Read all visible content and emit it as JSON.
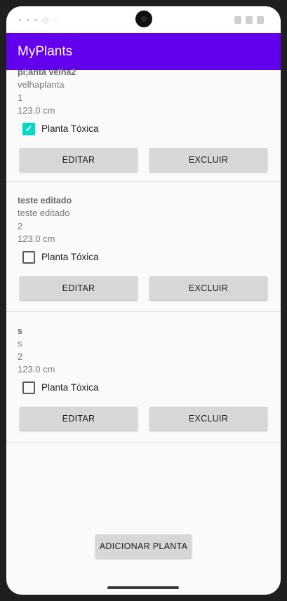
{
  "app": {
    "title": "MyPlants"
  },
  "status_bar": {
    "left_text": "▪ ▪ ▪ ◷  ◌"
  },
  "plants": [
    {
      "name": "pl;anta velha2",
      "description": "velhaplanta",
      "quantity": "1",
      "height": "123.0 cm",
      "toxic_label": "Planta Tóxica",
      "toxic_checked": true,
      "edit_label": "EDITAR",
      "delete_label": "EXCLUIR"
    },
    {
      "name": "teste editado",
      "description": "teste editado",
      "quantity": "2",
      "height": "123.0 cm",
      "toxic_label": "Planta Tóxica",
      "toxic_checked": false,
      "edit_label": "EDITAR",
      "delete_label": "EXCLUIR"
    },
    {
      "name": "s",
      "description": "s",
      "quantity": "2",
      "height": "123.0 cm",
      "toxic_label": "Planta Tóxica",
      "toxic_checked": false,
      "edit_label": "EDITAR",
      "delete_label": "EXCLUIR"
    }
  ],
  "add_button_label": "ADICIONAR PLANTA",
  "colors": {
    "app_bar": "#6200ee",
    "checkbox_checked": "#03dac5",
    "button_bg": "#d6d7d7"
  },
  "icons": {
    "check": "check-icon",
    "camera": "front-camera",
    "wifi": "wifi-icon",
    "signal": "signal-icon",
    "battery": "battery-icon"
  }
}
